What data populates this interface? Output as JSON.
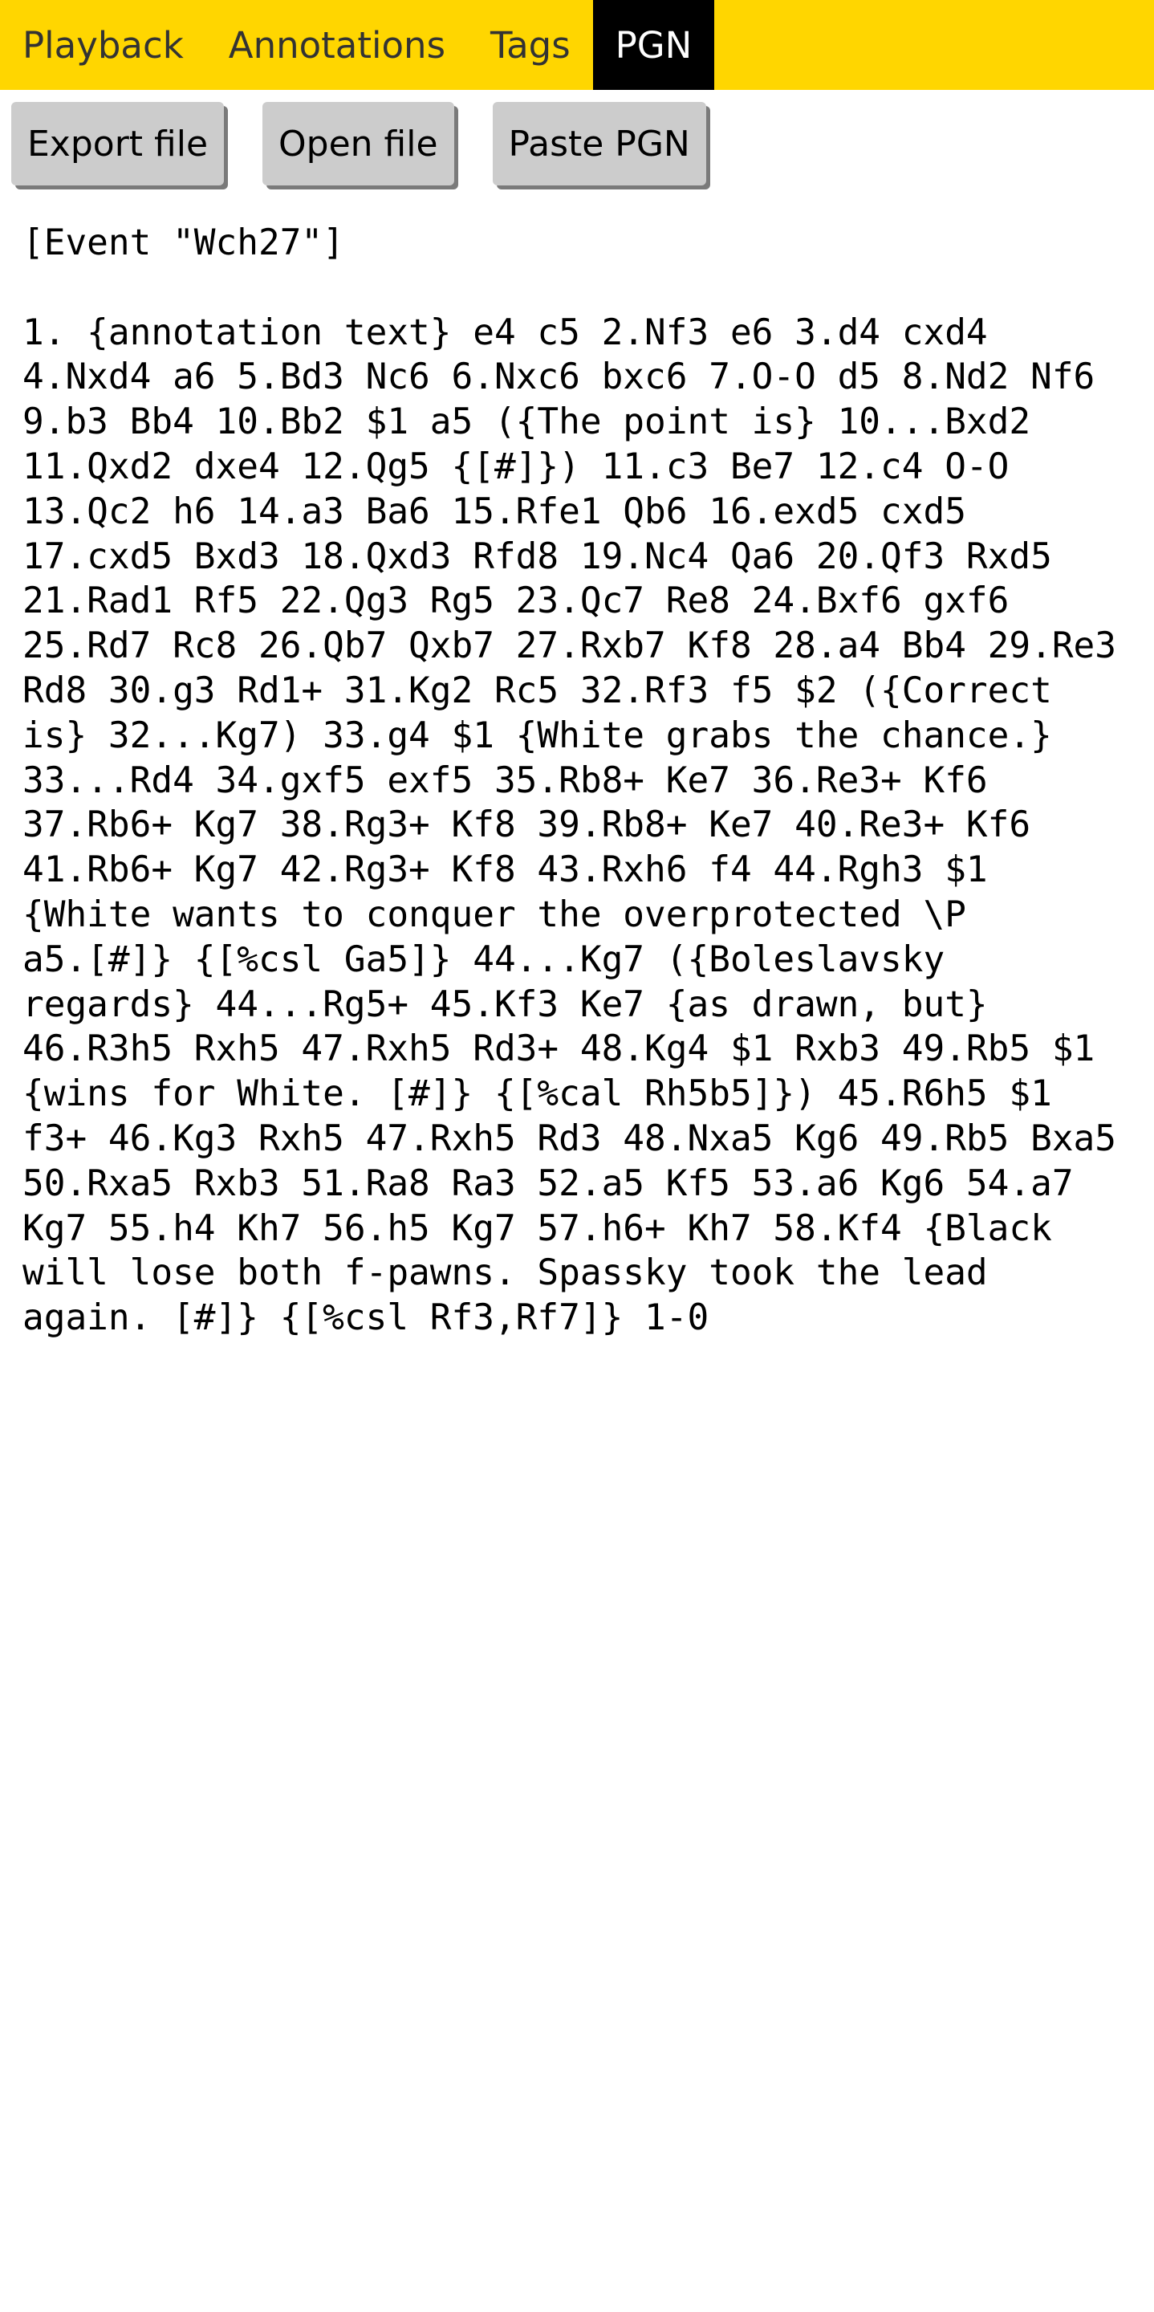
{
  "tabs": [
    {
      "label": "Playback",
      "active": false
    },
    {
      "label": "Annotations",
      "active": false
    },
    {
      "label": "Tags",
      "active": false
    },
    {
      "label": "PGN",
      "active": true
    }
  ],
  "toolbar": {
    "export_label": "Export file",
    "open_label": "Open file",
    "paste_label": "Paste PGN"
  },
  "pgn_text": "[Event \"Wch27\"]\n\n1. {annotation text} e4 c5 2.Nf3 e6 3.d4 cxd4\n4.Nxd4 a6 5.Bd3 Nc6 6.Nxc6 bxc6 7.O-O d5 8.Nd2 Nf6\n9.b3 Bb4 10.Bb2 $1 a5 ({The point is} 10...Bxd2\n11.Qxd2 dxe4 12.Qg5 {[#]}) 11.c3 Be7 12.c4 O-O\n13.Qc2 h6 14.a3 Ba6 15.Rfe1 Qb6 16.exd5 cxd5\n17.cxd5 Bxd3 18.Qxd3 Rfd8 19.Nc4 Qa6 20.Qf3 Rxd5\n21.Rad1 Rf5 22.Qg3 Rg5 23.Qc7 Re8 24.Bxf6 gxf6\n25.Rd7 Rc8 26.Qb7 Qxb7 27.Rxb7 Kf8 28.a4 Bb4 29.Re3\nRd8 30.g3 Rd1+ 31.Kg2 Rc5 32.Rf3 f5 $2 ({Correct\nis} 32...Kg7) 33.g4 $1 {White grabs the chance.}\n33...Rd4 34.gxf5 exf5 35.Rb8+ Ke7 36.Re3+ Kf6\n37.Rb6+ Kg7 38.Rg3+ Kf8 39.Rb8+ Ke7 40.Re3+ Kf6\n41.Rb6+ Kg7 42.Rg3+ Kf8 43.Rxh6 f4 44.Rgh3 $1\n{White wants to conquer the overprotected \\P\na5.[#]} {[%csl Ga5]} 44...Kg7 ({Boleslavsky\nregards} 44...Rg5+ 45.Kf3 Ke7 {as drawn, but}\n46.R3h5 Rxh5 47.Rxh5 Rd3+ 48.Kg4 $1 Rxb3 49.Rb5 $1\n{wins for White. [#]} {[%cal Rh5b5]}) 45.R6h5 $1\nf3+ 46.Kg3 Rxh5 47.Rxh5 Rd3 48.Nxa5 Kg6 49.Rb5 Bxa5\n50.Rxa5 Rxb3 51.Ra8 Ra3 52.a5 Kf5 53.a6 Kg6 54.a7\nKg7 55.h4 Kh7 56.h5 Kg7 57.h6+ Kh7 58.Kf4 {Black\nwill lose both f-pawns. Spassky took the lead\nagain. [#]} {[%csl Rf3,Rf7]} 1-0",
  "colors": {
    "tabbar_bg": "#ffd600",
    "tab_active_bg": "#000000",
    "tab_text": "#333333",
    "button_bg": "#cccccc"
  }
}
